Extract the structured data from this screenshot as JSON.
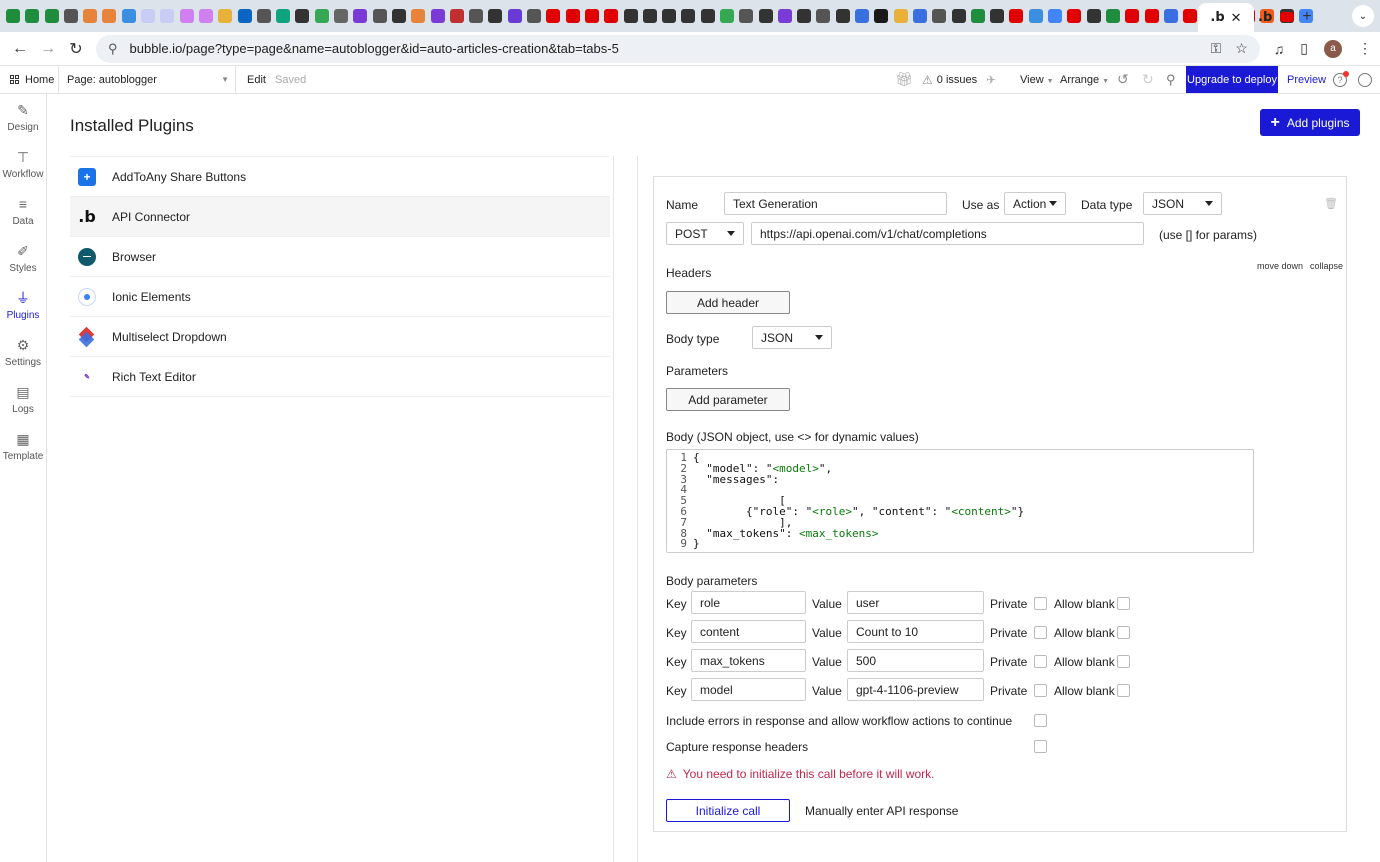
{
  "browser": {
    "tab_colors": [
      "#1e8e3e",
      "#1e8e3e",
      "#1e8e3e",
      "#555555",
      "#e8833a",
      "#e8833a",
      "#3a8fe0",
      "#c7cdf5",
      "#c7cdf5",
      "#d080f0",
      "#d080f0",
      "#e8b23a",
      "#0a66c2",
      "#555555",
      "#10a37f",
      "#333333",
      "#34a853",
      "#666666",
      "#7a3ad6",
      "#555555",
      "#333333",
      "#e8833a",
      "#7a3ad6",
      "#c03030",
      "#555555",
      "#333333",
      "#6a3ad6",
      "#555555",
      "#e00000",
      "#e00000",
      "#e00000",
      "#e00000",
      "#333333",
      "#333333",
      "#333333",
      "#333333",
      "#333333",
      "#34a853",
      "#555555",
      "#333333",
      "#7a3ad6",
      "#333333",
      "#555555",
      "#333333",
      "#3a6fe0",
      "#1a1a1a",
      "#e8b23a",
      "#3a6fe0",
      "#555555",
      "#333333",
      "#1e8e3e",
      "#333333",
      "#e00000",
      "#3a8fe0",
      "#4285f4",
      "#e00000",
      "#333333",
      "#1e8e3e",
      "#e00000",
      "#e00000",
      "#3a6fe0",
      "#e00000",
      "#2a6fb0",
      "#e00000",
      "#e00000",
      "#f05a1a",
      "#333333",
      "#4285f4"
    ],
    "active_tab_icon": ".b",
    "url": "bubble.io/page?type=page&name=autoblogger&id=auto-articles-creation&tab=tabs-5",
    "avatar_letter": "a"
  },
  "topbar": {
    "home": "Home",
    "page_label": "Page: autoblogger",
    "edit": "Edit",
    "saved": "Saved",
    "issues": "0 issues",
    "view": "View",
    "arrange": "Arrange",
    "upgrade": "Upgrade to deploy",
    "preview": "Preview",
    "help": "?"
  },
  "rail": [
    {
      "label": "Design",
      "icon": "design-icon",
      "glyph": "✎"
    },
    {
      "label": "Workflow",
      "icon": "workflow-icon",
      "glyph": "⊤"
    },
    {
      "label": "Data",
      "icon": "database-icon",
      "glyph": "≡"
    },
    {
      "label": "Styles",
      "icon": "brush-icon",
      "glyph": "✐"
    },
    {
      "label": "Plugins",
      "icon": "plug-icon",
      "glyph": "⏚",
      "active": true
    },
    {
      "label": "Settings",
      "icon": "gear-icon",
      "glyph": "⚙"
    },
    {
      "label": "Logs",
      "icon": "document-icon",
      "glyph": "▤"
    },
    {
      "label": "Template",
      "icon": "template-icon",
      "glyph": "▦"
    }
  ],
  "main": {
    "title": "Installed Plugins",
    "add_plugins": "Add plugins",
    "plugins": [
      {
        "name": "AddToAny Share Buttons",
        "icon": "share-plus-icon"
      },
      {
        "name": "API Connector",
        "icon": "bubble-logo-icon"
      },
      {
        "name": "Browser",
        "icon": "browser-icon"
      },
      {
        "name": "Ionic Elements",
        "icon": "ionic-icon"
      },
      {
        "name": "Multiselect Dropdown",
        "icon": "multiselect-icon"
      },
      {
        "name": "Rich Text Editor",
        "icon": "rich-text-icon"
      }
    ]
  },
  "call": {
    "move_down": "move down",
    "collapse": "collapse",
    "name_label": "Name",
    "name_value": "Text Generation",
    "use_as_label": "Use as",
    "use_as_value": "Action",
    "data_type_label": "Data type",
    "data_type_value": "JSON",
    "method": "POST",
    "endpoint": "https://api.openai.com/v1/chat/completions",
    "params_hint": "(use [] for params)",
    "headers_label": "Headers",
    "add_header": "Add header",
    "body_type_label": "Body type",
    "body_type_value": "JSON",
    "parameters_label": "Parameters",
    "add_parameter": "Add parameter",
    "body_label": "Body (JSON object, use <> for dynamic values)",
    "body_lines": [
      [
        "{"
      ],
      [
        "  \"model\": \"",
        "<model>",
        "\","
      ],
      [
        "  \"messages\":"
      ],
      [
        ""
      ],
      [
        "             ["
      ],
      [
        "        {\"role\": \"",
        "<role>",
        "\", \"content\": \"",
        "<content>",
        "\"}"
      ],
      [
        "             ],"
      ],
      [
        "  \"max_tokens\": ",
        "<max_tokens>",
        ""
      ],
      [
        "}"
      ]
    ],
    "body_params_label": "Body parameters",
    "key_label": "Key",
    "value_label": "Value",
    "private_label": "Private",
    "allow_blank_label": "Allow blank",
    "body_params": [
      {
        "key": "role",
        "value": "user"
      },
      {
        "key": "content",
        "value": "Count to 10"
      },
      {
        "key": "max_tokens",
        "value": "500"
      },
      {
        "key": "model",
        "value": "gpt-4-1106-preview"
      }
    ],
    "include_errors": "Include errors in response and allow workflow actions to continue",
    "capture_headers": "Capture response headers",
    "warning": "You need to initialize this call before it will work.",
    "initialize": "Initialize call",
    "manual": "Manually enter API response"
  }
}
